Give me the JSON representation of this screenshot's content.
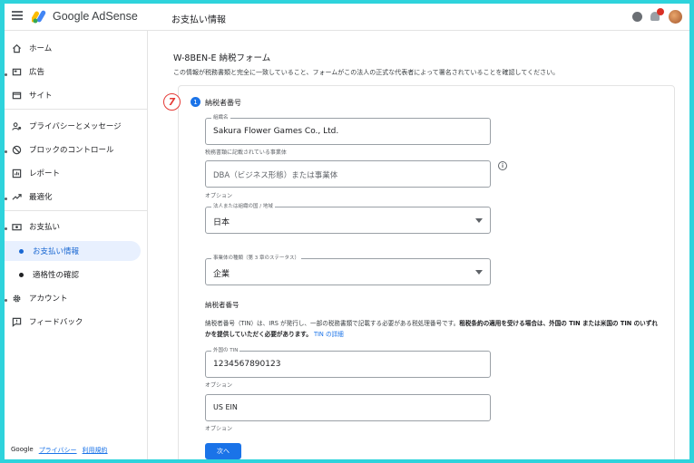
{
  "app": {
    "brand": "Google AdSense",
    "page_heading": "お支払い情報"
  },
  "sidebar": {
    "items": [
      {
        "label": "ホーム",
        "icon": "home-icon"
      },
      {
        "label": "広告",
        "icon": "ads-icon"
      },
      {
        "label": "サイト",
        "icon": "sites-icon"
      },
      {
        "label": "プライバシーとメッセージ",
        "icon": "privacy-icon"
      },
      {
        "label": "ブロックのコントロール",
        "icon": "block-icon"
      },
      {
        "label": "レポート",
        "icon": "reports-icon"
      },
      {
        "label": "最適化",
        "icon": "optimization-icon"
      },
      {
        "label": "お支払い",
        "icon": "payments-icon"
      },
      {
        "label": "お支払い情報",
        "icon": "bullet"
      },
      {
        "label": "適格性の確認",
        "icon": "bullet"
      },
      {
        "label": "アカウント",
        "icon": "account-icon"
      },
      {
        "label": "フィードバック",
        "icon": "feedback-icon"
      }
    ],
    "footer": {
      "google": "Google",
      "privacy": "プライバシー",
      "terms": "利用規約"
    }
  },
  "form": {
    "title": "W-8BEN-E 納税フォーム",
    "description": "この情報が税務書類と完全に一致していること、フォームがこの法人の正式な代表者によって署名されていることを確認してください。",
    "step_marker": "7",
    "section_number": "1",
    "section_title": "納税者番号",
    "org_name": {
      "label": "組織名",
      "value": "Sakura Flower Games Co., Ltd.",
      "hint": "税務書類に記載されている事業体"
    },
    "dba": {
      "placeholder": "DBA（ビジネス形態）または事業体",
      "hint": "オプション"
    },
    "country": {
      "label": "法人または組織の国 / 地域",
      "value": "日本"
    },
    "entity_type": {
      "label": "事業体の種類（第 3 章のステータス）",
      "value": "企業"
    },
    "tin_heading": "納税者番号",
    "tin_description_plain": "納税者番号（TIN）は、IRS が発行し、一部の税務書類で記載する必要がある税処理番号です。",
    "tin_description_bold": "租税条約の適用を受ける場合は、外国の TIN または米国の TIN のいずれかを提供していただく必要があります。",
    "tin_link": "TIN の詳細",
    "foreign_tin": {
      "label": "外国の TIN",
      "value": "1234567890123",
      "hint": "オプション"
    },
    "us_tin": {
      "value": "US EIN",
      "hint": "オプション"
    },
    "next_label": "次へ"
  },
  "colors": {
    "accent": "#1a73e8",
    "frame": "#2ed3dc",
    "step_marker": "#e53935",
    "active_nav_bg": "#e8f0fe"
  }
}
